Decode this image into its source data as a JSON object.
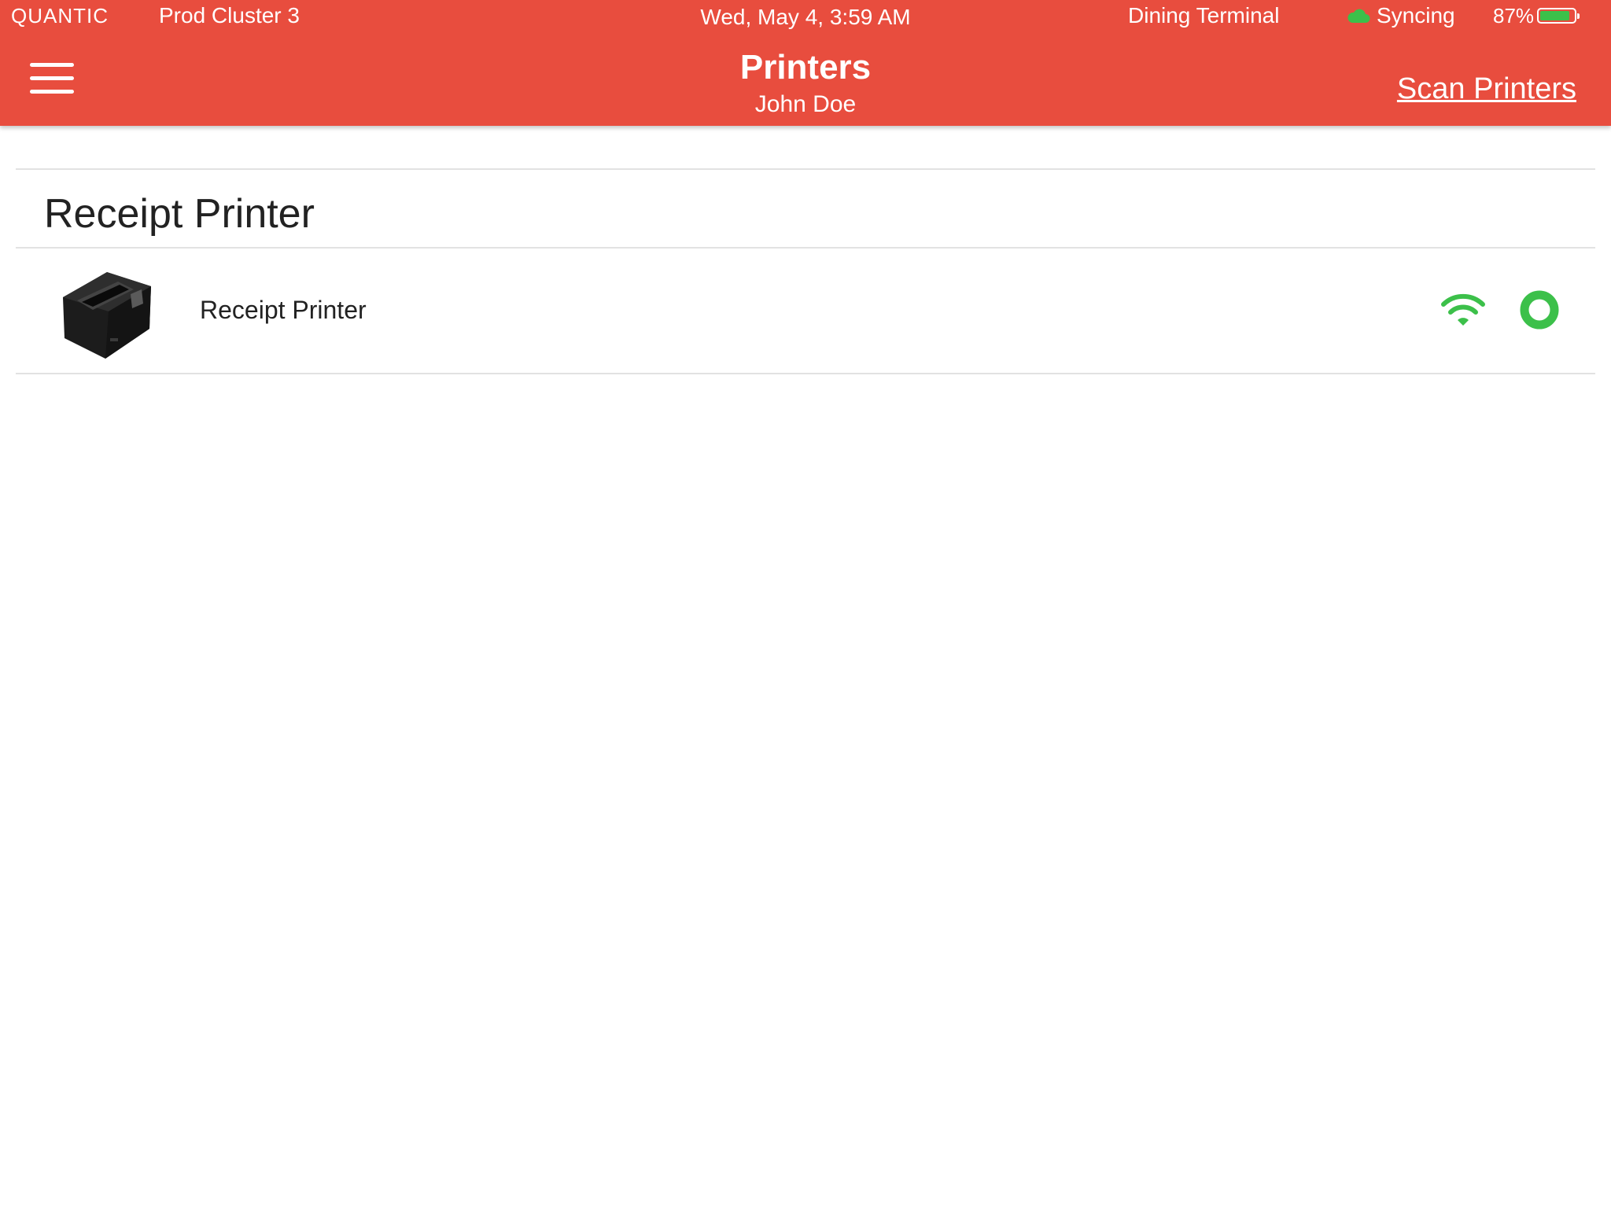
{
  "status_bar": {
    "brand": "QUANTIC",
    "cluster": "Prod Cluster 3",
    "datetime": "Wed, May 4, 3:59 AM",
    "terminal": "Dining Terminal",
    "sync_status": "Syncing",
    "sync_icon": "cloud-icon",
    "battery_percent": "87%",
    "battery_level": 0.87
  },
  "header": {
    "menu_icon": "hamburger-menu-icon",
    "title": "Printers",
    "subtitle": "John Doe",
    "action_label": "Scan Printers"
  },
  "section": {
    "title": "Receipt Printer"
  },
  "printers": [
    {
      "name": "Receipt Printer",
      "image_icon": "receipt-printer-icon",
      "connection_icon": "wifi-icon",
      "status_icon": "status-online-icon"
    }
  ],
  "colors": {
    "header_bg": "#e84d3e",
    "status_green": "#3cc04a",
    "divider": "#e2e2e2"
  }
}
